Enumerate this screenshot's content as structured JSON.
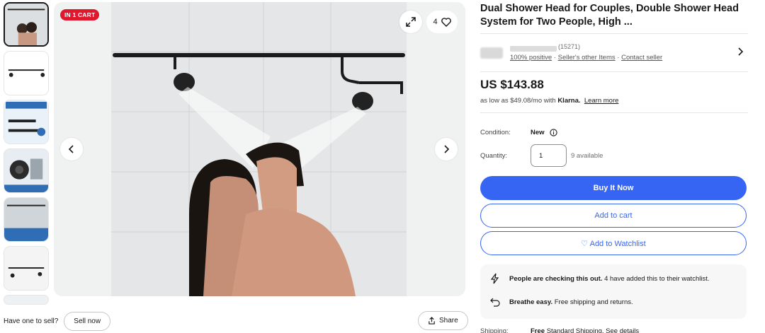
{
  "gallery": {
    "badge": "IN 1 CART",
    "watch_count": "4",
    "icons": {
      "expand": "expand-icon",
      "heart": "heart-icon",
      "prev": "chevron-left-icon",
      "next": "chevron-right-icon"
    }
  },
  "listing": {
    "title": "Dual Shower Head for Couples, Double Shower Head System for Two People, High ...",
    "seller": {
      "feedback_count": "(15271)",
      "positive": "100% positive",
      "other_items": "Seller's other Items",
      "contact": "Contact seller",
      "sep": "·"
    },
    "price": "US $143.88",
    "finance": {
      "prefix": "as low as $49.08/mo with",
      "provider": "Klarna.",
      "link": "Learn more"
    },
    "condition": {
      "label": "Condition:",
      "value": "New"
    },
    "quantity": {
      "label": "Quantity:",
      "value": "1",
      "available": "9 available"
    },
    "buttons": {
      "buy": "Buy It Now",
      "cart": "Add to cart",
      "watch": "♡ Add to Watchlist"
    },
    "info": [
      {
        "bold": "People are checking this out.",
        "text": " 4 have added this to their watchlist.",
        "icon": "lightning-icon"
      },
      {
        "bold": "Breathe easy.",
        "text": " Free shipping and returns.",
        "icon": "return-icon"
      }
    ],
    "shipping": {
      "label": "Shipping:",
      "bold": "Free",
      "text": " Standard Shipping. See details"
    }
  },
  "footer": {
    "have_one": "Have one to sell?",
    "sell_now": "Sell now",
    "share": "Share"
  },
  "colors": {
    "accent": "#3665f3",
    "badge": "#e0182d"
  }
}
